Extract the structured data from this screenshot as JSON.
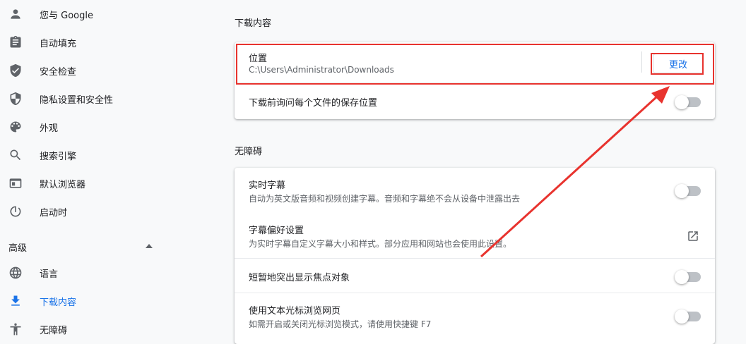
{
  "sidebar": {
    "items": [
      {
        "label": "您与 Google",
        "icon": "person-icon"
      },
      {
        "label": "自动填充",
        "icon": "clipboard-icon"
      },
      {
        "label": "安全检查",
        "icon": "shield-check-icon"
      },
      {
        "label": "隐私设置和安全性",
        "icon": "privacy-shield-icon"
      },
      {
        "label": "外观",
        "icon": "palette-icon"
      },
      {
        "label": "搜索引擎",
        "icon": "search-icon"
      },
      {
        "label": "默认浏览器",
        "icon": "browser-window-icon"
      },
      {
        "label": "启动时",
        "icon": "power-icon"
      }
    ],
    "advanced_label": "高级",
    "advanced_items": [
      {
        "label": "语言",
        "icon": "globe-icon"
      },
      {
        "label": "下载内容",
        "icon": "download-icon",
        "active": true
      },
      {
        "label": "无障碍",
        "icon": "accessibility-icon"
      }
    ]
  },
  "downloads": {
    "title": "下载内容",
    "location_label": "位置",
    "location_value": "C:\\Users\\Administrator\\Downloads",
    "change_button": "更改",
    "ask_label": "下载前询问每个文件的保存位置",
    "ask_enabled": false
  },
  "accessibility": {
    "title": "无障碍",
    "live_caption": {
      "label": "实时字幕",
      "desc": "自动为英文版音频和视频创建字幕。音频和字幕绝不会从设备中泄露出去",
      "enabled": false
    },
    "caption_prefs": {
      "label": "字幕偏好设置",
      "desc": "为实时字幕自定义字幕大小和样式。部分应用和网站也会使用此设置。"
    },
    "focus_highlight": {
      "label": "短暂地突出显示焦点对象",
      "enabled": false
    },
    "caret_browsing": {
      "label": "使用文本光标浏览网页",
      "desc": "如需开启或关闭光标浏览模式，请使用快捷键 F7",
      "enabled": false
    }
  },
  "colors": {
    "accent": "#1a73e8",
    "annotation_red": "#e8332e",
    "toggle_off": "#bdc1c6"
  }
}
